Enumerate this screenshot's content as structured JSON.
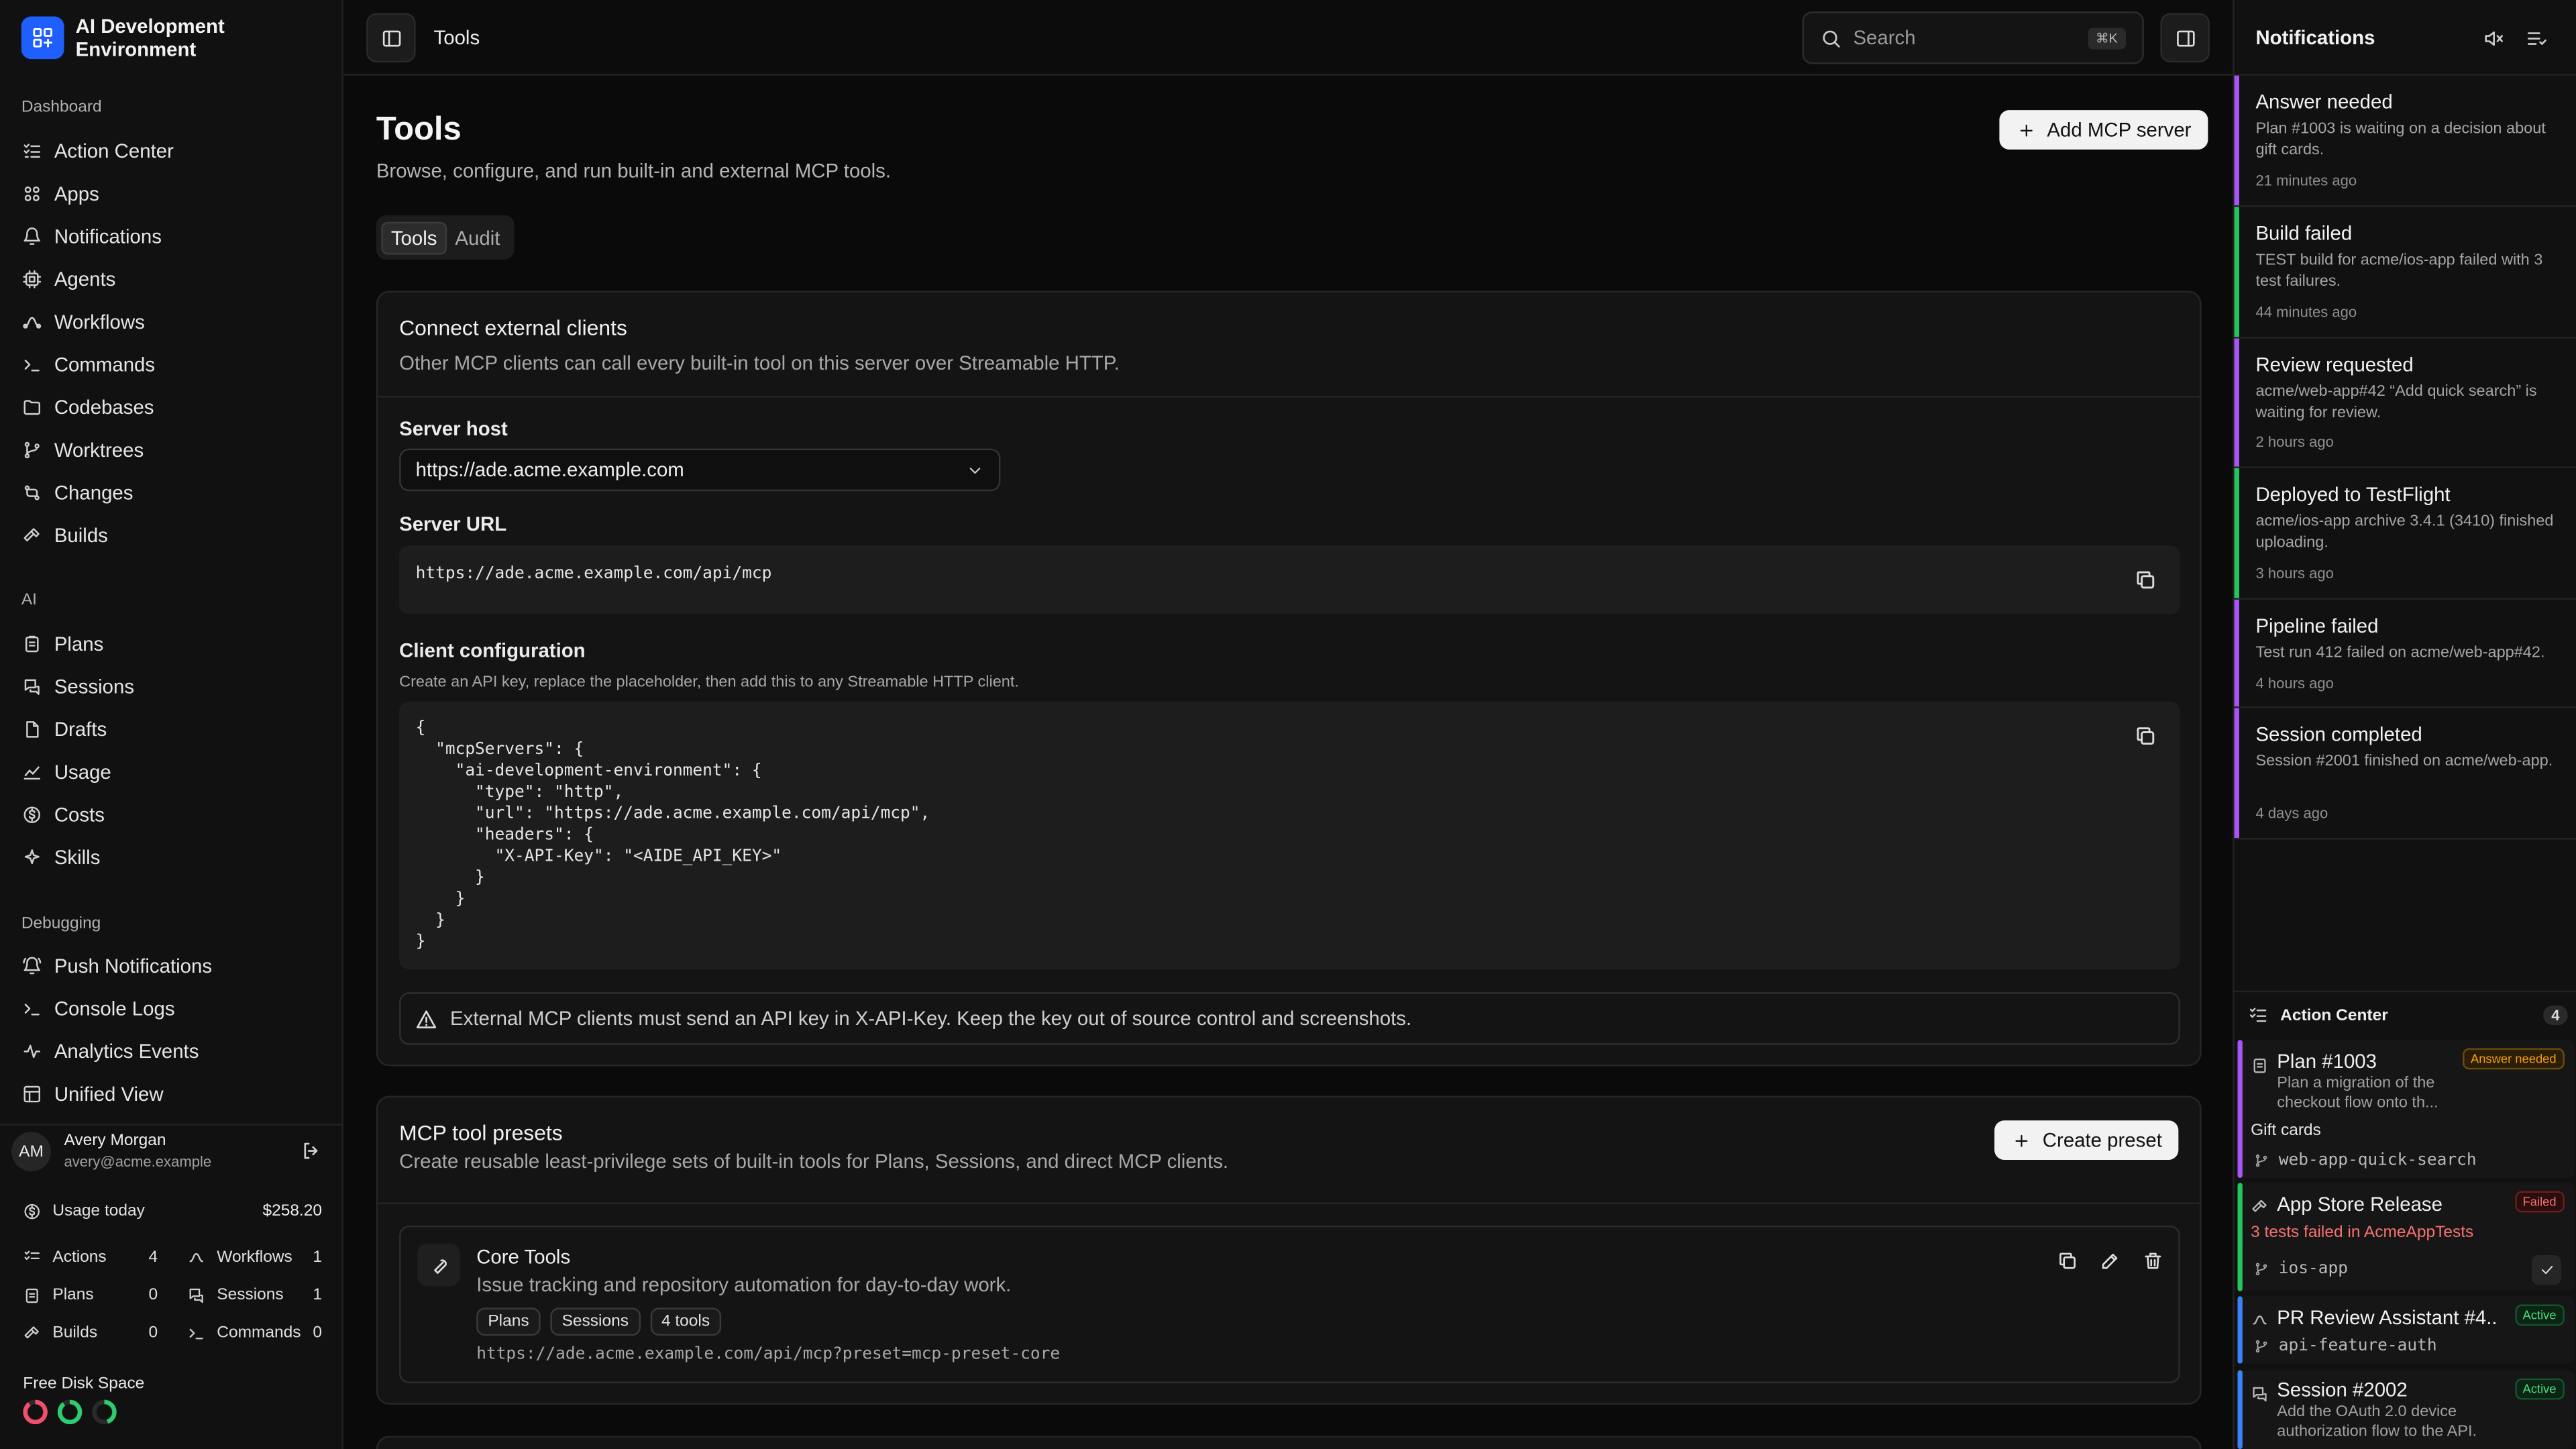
{
  "app": {
    "name": "AI Development Environment"
  },
  "sidebar": {
    "sections": [
      {
        "label": "Dashboard",
        "items": [
          {
            "label": "Action Center",
            "icon": "list-check-icon"
          },
          {
            "label": "Apps",
            "icon": "apps-icon"
          },
          {
            "label": "Notifications",
            "icon": "bell-icon"
          },
          {
            "label": "Agents",
            "icon": "cpu-icon"
          },
          {
            "label": "Workflows",
            "icon": "workflow-icon"
          },
          {
            "label": "Commands",
            "icon": "terminal-icon"
          },
          {
            "label": "Codebases",
            "icon": "folder-icon"
          },
          {
            "label": "Worktrees",
            "icon": "git-branch-icon"
          },
          {
            "label": "Changes",
            "icon": "git-compare-icon"
          },
          {
            "label": "Builds",
            "icon": "hammer-icon"
          }
        ]
      },
      {
        "label": "AI",
        "items": [
          {
            "label": "Plans",
            "icon": "clipboard-icon"
          },
          {
            "label": "Sessions",
            "icon": "chat-icon"
          },
          {
            "label": "Drafts",
            "icon": "file-icon"
          },
          {
            "label": "Usage",
            "icon": "chart-icon"
          },
          {
            "label": "Costs",
            "icon": "dollar-icon"
          },
          {
            "label": "Skills",
            "icon": "sparkle-icon"
          }
        ]
      },
      {
        "label": "Debugging",
        "items": [
          {
            "label": "Push Notifications",
            "icon": "bell-ring-icon"
          },
          {
            "label": "Console Logs",
            "icon": "terminal-icon"
          },
          {
            "label": "Analytics Events",
            "icon": "pulse-icon"
          },
          {
            "label": "Unified View",
            "icon": "layout-icon"
          }
        ]
      }
    ],
    "user": {
      "initials": "AM",
      "name": "Avery Morgan",
      "email": "avery@acme.example"
    },
    "usage": {
      "label": "Usage today",
      "value": "$258.20"
    },
    "stats": [
      {
        "label": "Actions",
        "value": "4"
      },
      {
        "label": "Workflows",
        "value": "1"
      },
      {
        "label": "Plans",
        "value": "0"
      },
      {
        "label": "Sessions",
        "value": "1"
      },
      {
        "label": "Builds",
        "value": "0"
      },
      {
        "label": "Commands",
        "value": "0"
      }
    ],
    "disk": {
      "label": "Free Disk Space",
      "rings": [
        {
          "color": "#f0506e",
          "fraction": 0.9
        },
        {
          "color": "#2ecc71",
          "fraction": 0.9
        },
        {
          "color": "#2ecc71",
          "fraction": 0.45
        }
      ]
    }
  },
  "header": {
    "breadcrumb": "Tools",
    "search_placeholder": "Search",
    "search_shortcut": "⌘K"
  },
  "main": {
    "title": "Tools",
    "subtitle": "Browse, configure, and run built-in and external MCP tools.",
    "add_button": "Add MCP server",
    "tabs": [
      "Tools",
      "Audit"
    ],
    "connect": {
      "title": "Connect external clients",
      "description": "Other MCP clients can call every built-in tool on this server over Streamable HTTP.",
      "host_label": "Server host",
      "host_value": "https://ade.acme.example.com",
      "url_label": "Server URL",
      "url_value": "https://ade.acme.example.com/api/mcp",
      "config_label": "Client configuration",
      "config_hint": "Create an API key, replace the placeholder, then add this to any Streamable HTTP client.",
      "config_code": "{\n  \"mcpServers\": {\n    \"ai-development-environment\": {\n      \"type\": \"http\",\n      \"url\": \"https://ade.acme.example.com/api/mcp\",\n      \"headers\": {\n        \"X-API-Key\": \"<AIDE_API_KEY>\"\n      }\n    }\n  }\n}",
      "warning": "External MCP clients must send an API key in X-API-Key. Keep the key out of source control and screenshots."
    },
    "presets": {
      "title": "MCP tool presets",
      "description": "Create reusable least-privilege sets of built-in tools for Plans, Sessions, and direct MCP clients.",
      "create_button": "Create preset",
      "items": [
        {
          "name": "Core Tools",
          "description": "Issue tracking and repository automation for day-to-day work.",
          "tags": [
            "Plans",
            "Sessions",
            "4 tools"
          ],
          "url": "https://ade.acme.example.com/api/mcp?preset=mcp-preset-core"
        }
      ]
    }
  },
  "notifications": {
    "title": "Notifications",
    "items": [
      {
        "title": "Answer needed",
        "body": "Plan #1003 is waiting on a decision about gift cards.",
        "time": "21 minutes ago",
        "color": "#a855f7"
      },
      {
        "title": "Build failed",
        "body": "TEST build for acme/ios-app failed with 3 test failures.",
        "time": "44 minutes ago",
        "color": "#22c55e"
      },
      {
        "title": "Review requested",
        "body": "acme/web-app#42 “Add quick search” is waiting for review.",
        "time": "2 hours ago",
        "color": "#a855f7"
      },
      {
        "title": "Deployed to TestFlight",
        "body": "acme/ios-app archive 3.4.1 (3410) finished uploading.",
        "time": "3 hours ago",
        "color": "#22c55e"
      },
      {
        "title": "Pipeline failed",
        "body": "Test run 412 failed on acme/web-app#42.",
        "time": "4 hours ago",
        "color": "#a855f7"
      },
      {
        "title": "Session completed",
        "body": "Session #2001 finished on acme/web-app.",
        "time": "4 days ago",
        "color": "#a855f7"
      }
    ],
    "action_center": {
      "title": "Action Center",
      "count": "4",
      "items": [
        {
          "title": "Plan #1003",
          "badge": "Answer needed",
          "body": "Plan a migration of the checkout flow onto th...",
          "extra": "Gift cards",
          "branch": "web-app-quick-search",
          "color": "#a855f7"
        },
        {
          "title": "App Store Release",
          "badge": "Failed",
          "extra": "3 tests failed in AcmeAppTests",
          "branch": "ios-app",
          "color": "#22c55e"
        },
        {
          "title": "PR Review Assistant #4...",
          "badge": "Active",
          "branch": "api-feature-auth",
          "color": "#3b82f6"
        },
        {
          "title": "Session #2002",
          "badge": "Active",
          "body": "Add the OAuth 2.0 device authorization flow to the API.",
          "color": "#3b82f6"
        }
      ]
    }
  }
}
